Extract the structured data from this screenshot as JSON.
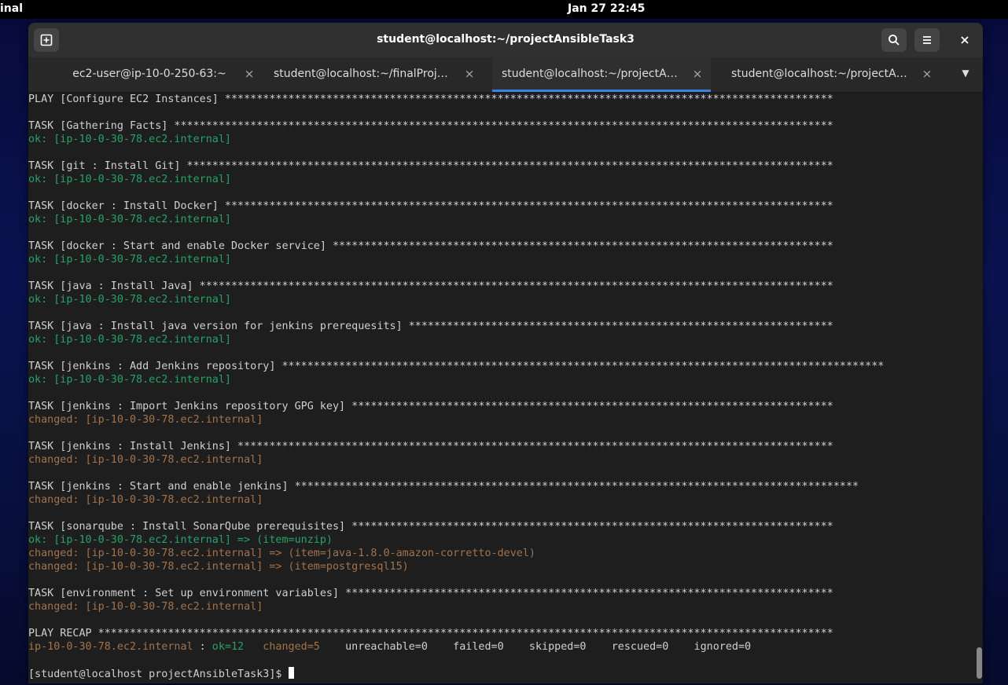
{
  "topbar": {
    "app_name": "inal",
    "clock": "Jan 27  22:45"
  },
  "window": {
    "title": "student@localhost:~/projectAnsibleTask3",
    "newtab_icon": "new-tab-icon",
    "search_icon": "search-icon",
    "menu_icon": "hamburger-menu-icon",
    "close_icon": "close-icon"
  },
  "tabs": [
    {
      "label": "ec2-user@ip-10-0-250-63:~",
      "active": false
    },
    {
      "label": "student@localhost:~/finalProjec…",
      "active": false
    },
    {
      "label": "student@localhost:~/projectAnsi…",
      "active": true
    },
    {
      "label": "student@localhost:~/projectAnsi…",
      "active": false
    }
  ],
  "terminal": {
    "lines": [
      {
        "t": "PLAY [Configure EC2 Instances] ************************************************************************************************"
      },
      {
        "t": ""
      },
      {
        "t": "TASK [Gathering Facts] ********************************************************************************************************"
      },
      {
        "t": "ok: [ip-10-0-30-78.ec2.internal]",
        "c": "ok"
      },
      {
        "t": ""
      },
      {
        "t": "TASK [git : Install Git] ******************************************************************************************************"
      },
      {
        "t": "ok: [ip-10-0-30-78.ec2.internal]",
        "c": "ok"
      },
      {
        "t": ""
      },
      {
        "t": "TASK [docker : Install Docker] ************************************************************************************************"
      },
      {
        "t": "ok: [ip-10-0-30-78.ec2.internal]",
        "c": "ok"
      },
      {
        "t": ""
      },
      {
        "t": "TASK [docker : Start and enable Docker service] *******************************************************************************"
      },
      {
        "t": "ok: [ip-10-0-30-78.ec2.internal]",
        "c": "ok"
      },
      {
        "t": ""
      },
      {
        "t": "TASK [java : Install Java] ****************************************************************************************************"
      },
      {
        "t": "ok: [ip-10-0-30-78.ec2.internal]",
        "c": "ok"
      },
      {
        "t": ""
      },
      {
        "t": "TASK [java : Install java version for jenkins prerequesits] *******************************************************************"
      },
      {
        "t": "ok: [ip-10-0-30-78.ec2.internal]",
        "c": "ok"
      },
      {
        "t": ""
      },
      {
        "t": "TASK [jenkins : Add Jenkins repository] ***********************************************************************************************"
      },
      {
        "t": "ok: [ip-10-0-30-78.ec2.internal]",
        "c": "ok"
      },
      {
        "t": ""
      },
      {
        "t": "TASK [jenkins : Import Jenkins repository GPG key] ****************************************************************************"
      },
      {
        "t": "changed: [ip-10-0-30-78.ec2.internal]",
        "c": "changed"
      },
      {
        "t": ""
      },
      {
        "t": "TASK [jenkins : Install Jenkins] **********************************************************************************************"
      },
      {
        "t": "changed: [ip-10-0-30-78.ec2.internal]",
        "c": "changed"
      },
      {
        "t": ""
      },
      {
        "t": "TASK [jenkins : Start and enable jenkins] *****************************************************************************************"
      },
      {
        "t": "changed: [ip-10-0-30-78.ec2.internal]",
        "c": "changed"
      },
      {
        "t": ""
      },
      {
        "t": "TASK [sonarqube : Install SonarQube prerequisites] ****************************************************************************"
      },
      {
        "t": "ok: [ip-10-0-30-78.ec2.internal] => (item=unzip)",
        "c": "ok"
      },
      {
        "t": "changed: [ip-10-0-30-78.ec2.internal] => (item=java-1.8.0-amazon-corretto-devel)",
        "c": "changed"
      },
      {
        "t": "changed: [ip-10-0-30-78.ec2.internal] => (item=postgresql15)",
        "c": "changed"
      },
      {
        "t": ""
      },
      {
        "t": "TASK [environment : Set up environment variables] *****************************************************************************"
      },
      {
        "t": "changed: [ip-10-0-30-78.ec2.internal]",
        "c": "changed"
      },
      {
        "t": ""
      },
      {
        "t": "PLAY RECAP ********************************************************************************************************************"
      }
    ],
    "recap": {
      "host": "ip-10-0-30-78.ec2.internal",
      "sep": " : ",
      "ok": "ok=12",
      "changed": "changed=5",
      "rest": "    unreachable=0    failed=0    skipped=0    rescued=0    ignored=0"
    },
    "prompt": "[student@localhost projectAnsibleTask3]$ "
  },
  "colors": {
    "ok": "#26a269",
    "changed": "#a2734c",
    "accent": "#3584e4"
  }
}
